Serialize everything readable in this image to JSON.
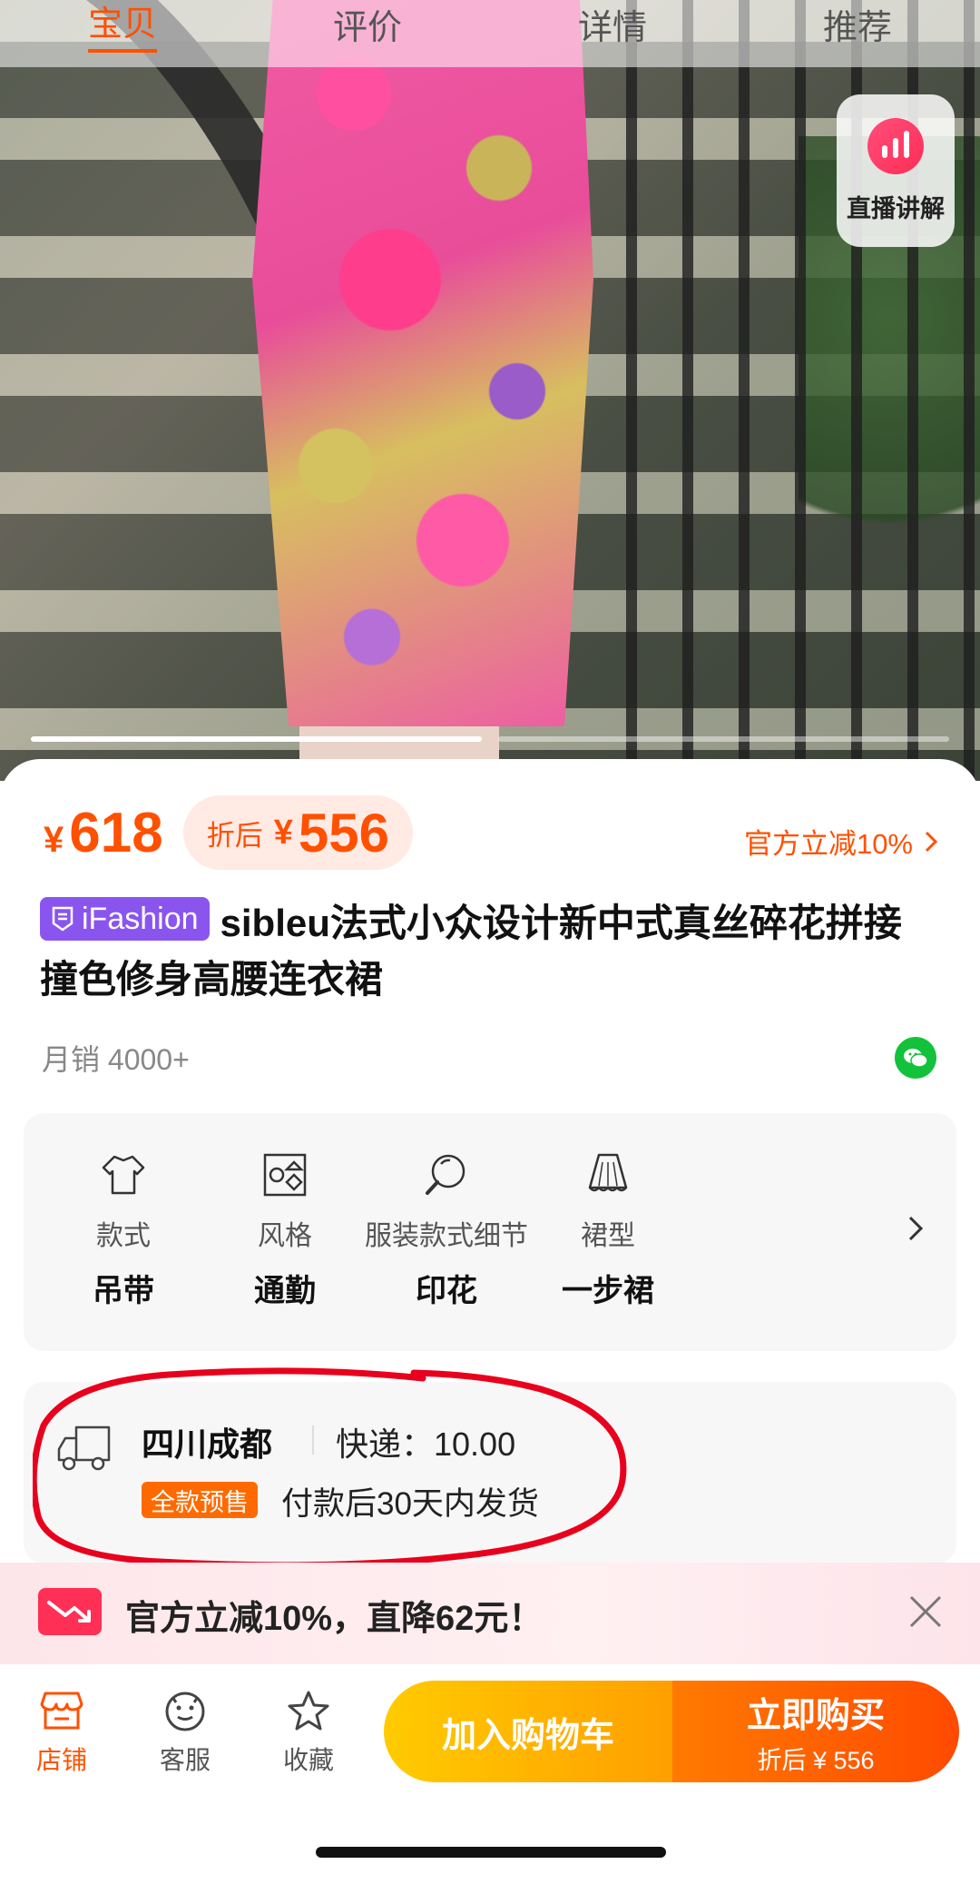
{
  "top_tabs": [
    {
      "label": "宝贝"
    },
    {
      "label": "评价"
    },
    {
      "label": "详情"
    },
    {
      "label": "推荐"
    }
  ],
  "live_button": {
    "label": "直播讲解",
    "icon": "live-chart-icon"
  },
  "gallery": {
    "slide_current": 1,
    "slide_total": 2
  },
  "price": {
    "currency": "¥",
    "original": "618",
    "after_label": "折后",
    "after_value": "556",
    "discount_link": "官方立减10%"
  },
  "product": {
    "badge": "iFashion",
    "title": "sibleu法式小众设计新中式真丝碎花拼接撞色修身高腰连衣裙",
    "sales": "月销 4000+"
  },
  "attributes": [
    {
      "key": "款式",
      "value": "吊带",
      "icon": "top-garment-icon"
    },
    {
      "key": "风格",
      "value": "通勤",
      "icon": "style-shapes-icon"
    },
    {
      "key": "服装款式细节",
      "value": "印花",
      "icon": "magnifier-icon"
    },
    {
      "key": "裙型",
      "value": "一步裙",
      "icon": "skirt-icon"
    }
  ],
  "shipping": {
    "origin": "四川成都",
    "fee": "快递：10.00",
    "presale_tag": "全款预售",
    "note": "付款后30天内发货"
  },
  "banner": {
    "text": "官方立减10%，直降62元！"
  },
  "bottom_nav": [
    {
      "label": "店铺",
      "icon": "store-icon"
    },
    {
      "label": "客服",
      "icon": "customer-service-icon"
    },
    {
      "label": "收藏",
      "icon": "star-icon"
    }
  ],
  "actions": {
    "cart": "加入购物车",
    "buy": "立即购买",
    "buy_sub": "折后 ¥ 556"
  },
  "colors": {
    "accent": "#ff5000",
    "badge": "#8a55ee",
    "annotation": "#e8001c",
    "wechat": "#12c23a"
  }
}
